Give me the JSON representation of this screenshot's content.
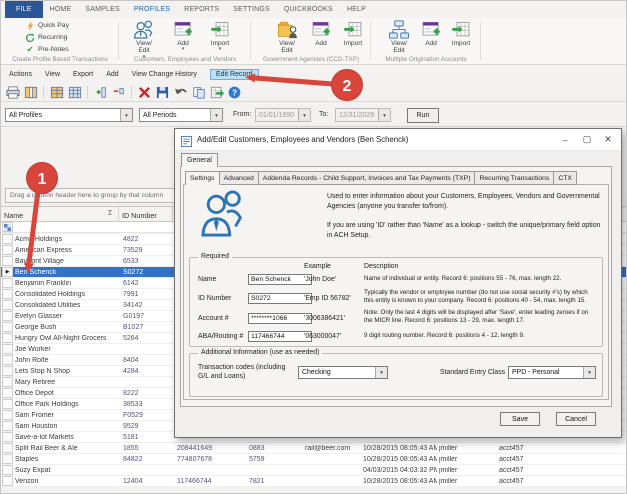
{
  "ribbon": {
    "tabs": [
      "FILE",
      "HOME",
      "SAMPLES",
      "PROFILES",
      "REPORTS",
      "SETTINGS",
      "QUICKBOOKS",
      "HELP"
    ],
    "active_tab": "PROFILES",
    "groups": [
      {
        "label": "Create Profile Based Transactions",
        "items": [
          "Quick Pay",
          "Recurring",
          "Pre-Notes"
        ]
      },
      {
        "label": "Customers, Employees and Vendors",
        "items": [
          "View/ Edit",
          "Add",
          "Import"
        ]
      },
      {
        "label": "Government Agencies (CCD-TXP)",
        "items": [
          "View/ Edit",
          "Add",
          "Import"
        ]
      },
      {
        "label": "Multiple Origination Accounts",
        "items": [
          "View/ Edit",
          "Add",
          "Import"
        ]
      }
    ]
  },
  "menubar": {
    "items": [
      "Actions",
      "View",
      "Export",
      "Add",
      "View Change History",
      "Edit Record"
    ],
    "highlighted": "Edit Record"
  },
  "toolbar": {
    "icon_names": [
      "print-icon",
      "columns-icon",
      "grid-settings-icon",
      "grid-view-icon",
      "add-column-icon",
      "remove-column-icon",
      "delete-icon",
      "save-icon",
      "undo-icon",
      "copy-icon",
      "export-excel-icon",
      "help-icon"
    ]
  },
  "filterbar": {
    "profiles_value": "All Profiles",
    "periods_value": "All Periods",
    "from_label": "From:",
    "from_value": "01/01/1990",
    "to_label": "To:",
    "to_value": "12/31/2029",
    "run_label": "Run"
  },
  "grid": {
    "group_panel": "Drag a column header here to group by that column",
    "columns": [
      "Name",
      "ID Number"
    ],
    "rows": [
      {
        "name": "Acme Holdings",
        "id": "4822"
      },
      {
        "name": "American Express",
        "id": "73529"
      },
      {
        "name": "Bayfront Village",
        "id": "6533"
      },
      {
        "name": "Ben Schenck",
        "id": "S0272",
        "selected": true
      },
      {
        "name": "Benjamin Franklin",
        "id": "6142"
      },
      {
        "name": "Consolidated Holdings",
        "id": "7991"
      },
      {
        "name": "Consolidated Utilities",
        "id": "34142"
      },
      {
        "name": "Evelyn Glasser",
        "id": "G0197"
      },
      {
        "name": "George Bush",
        "id": "B1027"
      },
      {
        "name": "Hungry Owl All-Night Grocers",
        "id": "5264"
      },
      {
        "name": "Joe Worker",
        "id": ""
      },
      {
        "name": "John Rolfe",
        "id": "8404"
      },
      {
        "name": "Lets Stop N Shop",
        "id": "4284"
      },
      {
        "name": "Mary Retiree",
        "id": ""
      },
      {
        "name": "Office Depot",
        "id": "8222"
      },
      {
        "name": "Office Park Holdings",
        "id": "38533"
      },
      {
        "name": "Sam Fromer",
        "id": "F0529"
      },
      {
        "name": "Sam Houston",
        "id": "9529"
      },
      {
        "name": "Save-a-lot Markets",
        "id": "5181"
      },
      {
        "name": "Split Rail Beer & Ale",
        "id": "1855",
        "routing": "208441649",
        "acct4": "0883",
        "email": "rail@beer.com",
        "changed": "10/28/2015 08:05:43 AM",
        "user": "jmiller",
        "account": "acct457"
      },
      {
        "name": "Staples",
        "id": "84822",
        "routing": "774807678",
        "acct4": "5759",
        "email": "",
        "changed": "10/28/2015 08:05:43 AM",
        "user": "jmiller",
        "account": "acct457"
      },
      {
        "name": "Suzy Expat",
        "id": "",
        "changed": "04/03/2015 04:03:32 PM",
        "user": "jmiller",
        "account": "acct457"
      },
      {
        "name": "Verizon",
        "id": "12404",
        "routing": "117466744",
        "acct4": "7821",
        "changed": "10/28/2015 08:05:43 AM",
        "user": "jmiller",
        "account": "acct457"
      }
    ]
  },
  "dialog": {
    "title": "Add/Edit Customers, Employees and Vendors (Ben Schenck)",
    "outer_tab": "General",
    "tabs": [
      "Settings",
      "Advanced",
      "Addenda Records - Child Support, Invoices and Tax Payments (TXP)",
      "Recurring Transactions",
      "CTX"
    ],
    "active_tab": "Settings",
    "intro1": "Used to enter information about your Customers, Employees, Vendors and Governmental Agencies (anyone you transfer to/from).",
    "intro2": "If you are using 'ID' rather than 'Name' as a lookup - switch the unique/primary field option in ACH Setup.",
    "required": {
      "legend": "Required",
      "example_header": "Example",
      "description_header": "Description",
      "fields": [
        {
          "label": "Name",
          "value": "Ben Schenck",
          "example": "'John Doe'",
          "desc": "Name of individual or entity. Record 6: positions 55 - 76, max. length 22."
        },
        {
          "label": "ID Number",
          "value": "S0272",
          "example": "'Emp ID 56782'",
          "desc": "Typically the vendor or employee number (do not use social security #'s) by which this entity is known to your company. Record 6: positions 40 - 54, max. length 15."
        },
        {
          "label": "Account #",
          "value": "********1066",
          "example": "'3006386421'",
          "desc": "Note: Only the last 4 digits will be displayed after 'Save'; enter leading zeroes if on the MICR line. Record 6: positions 13 - 29, max. length 17."
        },
        {
          "label": "ABA/Routing #",
          "value": "117466744",
          "example": "'063000047'",
          "desc": "9 digit routing number. Record 6: positions 4 - 12, length 9."
        }
      ]
    },
    "additional": {
      "legend": "Additional Information (use as needed)",
      "txn_label": "Transaction codes (including G/L and Loans)",
      "txn_value": "Checking",
      "sec_label": "Standard Entry Class",
      "sec_value": "PPD - Personal"
    },
    "save_label": "Save",
    "cancel_label": "Cancel"
  },
  "callouts": {
    "one": "1",
    "two": "2"
  },
  "icons": {
    "sigma": "Σ",
    "caret": "▾",
    "dropdown": "▼",
    "row_pointer": "▶",
    "minimize": "–",
    "maximize": "▢",
    "close": "✕",
    "check": "✔",
    "question": "?"
  },
  "colors": {
    "accent_blue": "#2b5797",
    "callout_red": "#d9453b",
    "selection_blue": "#3272c8",
    "highlight_blue": "#b9e0f7"
  }
}
